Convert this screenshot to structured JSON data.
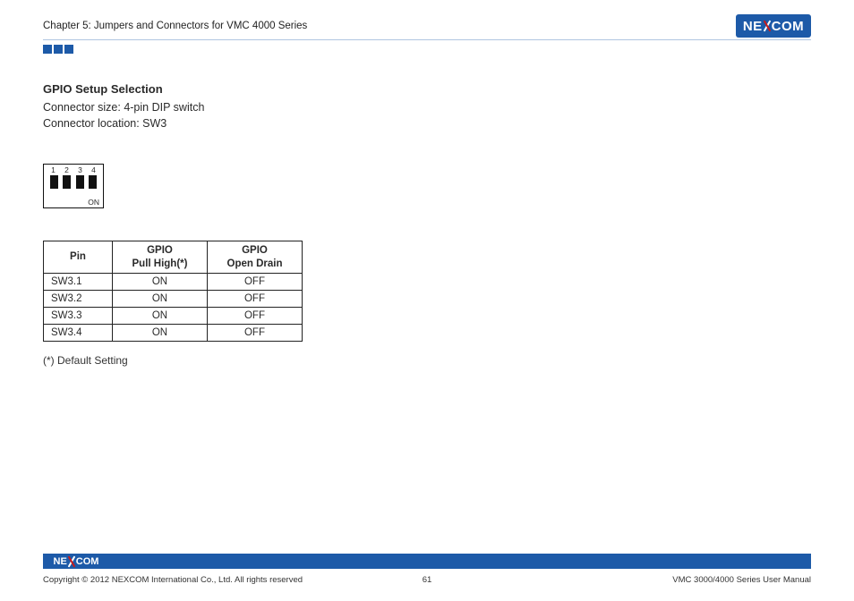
{
  "header": {
    "chapter": "Chapter 5: Jumpers and Connectors for VMC 4000 Series",
    "logo_text": {
      "left": "NE",
      "right": "COM"
    }
  },
  "section": {
    "heading": "GPIO Setup Selection",
    "line1": "Connector size: 4-pin DIP switch",
    "line2": "Connector location: SW3"
  },
  "dip": {
    "labels": [
      "1",
      "2",
      "3",
      "4"
    ],
    "on": "ON"
  },
  "table": {
    "head": {
      "c1": "Pin",
      "c2a": "GPIO",
      "c2b": "Pull High(*)",
      "c3a": "GPIO",
      "c3b": "Open Drain"
    },
    "rows": [
      {
        "pin": "SW3.1",
        "pull": "ON",
        "drain": "OFF"
      },
      {
        "pin": "SW3.2",
        "pull": "ON",
        "drain": "OFF"
      },
      {
        "pin": "SW3.3",
        "pull": "ON",
        "drain": "OFF"
      },
      {
        "pin": "SW3.4",
        "pull": "ON",
        "drain": "OFF"
      }
    ]
  },
  "note": "(*) Default Setting",
  "footer": {
    "copyright": "Copyright © 2012 NEXCOM International Co., Ltd. All rights reserved",
    "page": "61",
    "manual": "VMC 3000/4000 Series User Manual",
    "logo_text": {
      "left": "NE",
      "right": "COM"
    }
  }
}
